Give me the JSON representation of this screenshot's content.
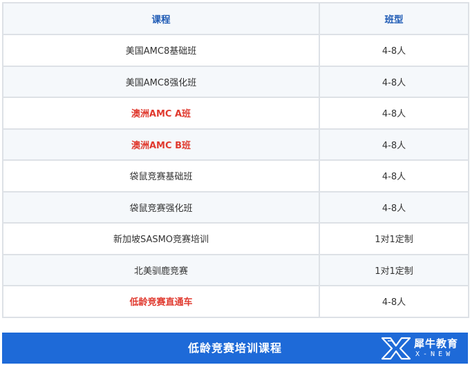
{
  "table": {
    "headers": [
      "课程",
      "班型"
    ],
    "rows": [
      {
        "course": "美国AMC8基础班",
        "class_type": "4-8人",
        "highlight": false
      },
      {
        "course": "美国AMC8强化班",
        "class_type": "4-8人",
        "highlight": false
      },
      {
        "course": "澳洲AMC A班",
        "class_type": "4-8人",
        "highlight": true
      },
      {
        "course": "澳洲AMC B班",
        "class_type": "4-8人",
        "highlight": true
      },
      {
        "course": "袋鼠竞赛基础班",
        "class_type": "4-8人",
        "highlight": false
      },
      {
        "course": "袋鼠竞赛强化班",
        "class_type": "4-8人",
        "highlight": false
      },
      {
        "course": "新加坡SASMO竞赛培训",
        "class_type": "1对1定制",
        "highlight": false
      },
      {
        "course": "北美驯鹿竞赛",
        "class_type": "1对1定制",
        "highlight": false
      },
      {
        "course": "低龄竞赛直通车",
        "class_type": "4-8人",
        "highlight": true
      }
    ]
  },
  "banner": {
    "title": "低龄竞赛培训课程",
    "logo_cn": "犀牛教育",
    "logo_en": "X-NEW",
    "logo_icon": "x-new-logo-icon"
  },
  "colors": {
    "header_text": "#1f5bb5",
    "highlight_text": "#e03a2f",
    "banner_bg": "#1e6ad8",
    "shaded_row": "#f5f8fb",
    "border": "#dde1e6"
  }
}
